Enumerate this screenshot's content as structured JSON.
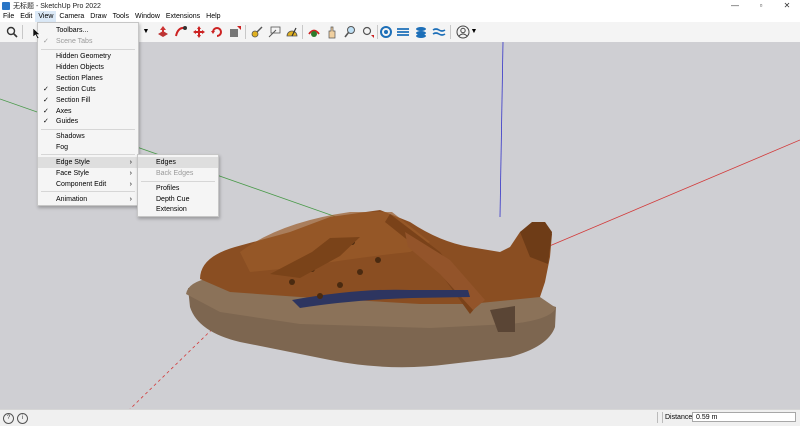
{
  "window": {
    "title": "无标题 - SketchUp Pro 2022",
    "buttons": [
      "—",
      "▫",
      "✕"
    ]
  },
  "menubar": [
    "File",
    "Edit",
    "View",
    "Camera",
    "Draw",
    "Tools",
    "Window",
    "Extensions",
    "Help"
  ],
  "view_menu": {
    "items": [
      {
        "label": "Toolbars...",
        "checked": false,
        "disabled": false
      },
      {
        "label": "Scene Tabs",
        "checked": true,
        "disabled": true
      },
      {
        "label": "Hidden Geometry",
        "checked": false,
        "disabled": false
      },
      {
        "label": "Hidden Objects",
        "checked": false,
        "disabled": false
      },
      {
        "label": "Section Planes",
        "checked": false,
        "disabled": false
      },
      {
        "label": "Section Cuts",
        "checked": true,
        "disabled": false
      },
      {
        "label": "Section Fill",
        "checked": true,
        "disabled": false
      },
      {
        "label": "Axes",
        "checked": true,
        "disabled": false
      },
      {
        "label": "Guides",
        "checked": true,
        "disabled": false
      },
      {
        "label": "Shadows",
        "checked": false,
        "disabled": false
      },
      {
        "label": "Fog",
        "checked": false,
        "disabled": false
      },
      {
        "label": "Edge Style",
        "submenu": true,
        "highlighted": true
      },
      {
        "label": "Face Style",
        "submenu": true
      },
      {
        "label": "Component Edit",
        "submenu": true
      },
      {
        "label": "Animation",
        "submenu": true
      }
    ]
  },
  "edge_style_submenu": {
    "items": [
      {
        "label": "Edges",
        "disabled": false,
        "highlighted": true
      },
      {
        "label": "Back Edges",
        "disabled": true
      },
      {
        "label": "Profiles",
        "disabled": false
      },
      {
        "label": "Depth Cue",
        "disabled": false
      },
      {
        "label": "Extension",
        "disabled": false
      }
    ]
  },
  "status": {
    "distance_label": "Distance",
    "distance_value": "0.59 m"
  },
  "colors": {
    "viewport_bg": "#cfcfd3",
    "axis_red": "#d23a3a",
    "axis_green": "#3fa53f",
    "axis_blue": "#3535c8",
    "shoe_leather": "#8a4e22",
    "shoe_sole": "#7d6650",
    "menu_highlight": "#dedede"
  },
  "toolbar_icons": [
    "zoom-icon",
    "select-cursor-icon",
    "dropdown-arrow-icon",
    "push-pull-icon",
    "follow-me-icon",
    "move-icon",
    "rotate-icon",
    "scale-icon",
    "tape-measure-icon",
    "dimension-icon",
    "protractor-icon",
    "orbit-icon",
    "pan-icon",
    "zoom-view-icon",
    "zoom-extents-icon",
    "sandbox-icon",
    "layers-icon",
    "styles-icon",
    "shadows-icon",
    "account-icon"
  ]
}
